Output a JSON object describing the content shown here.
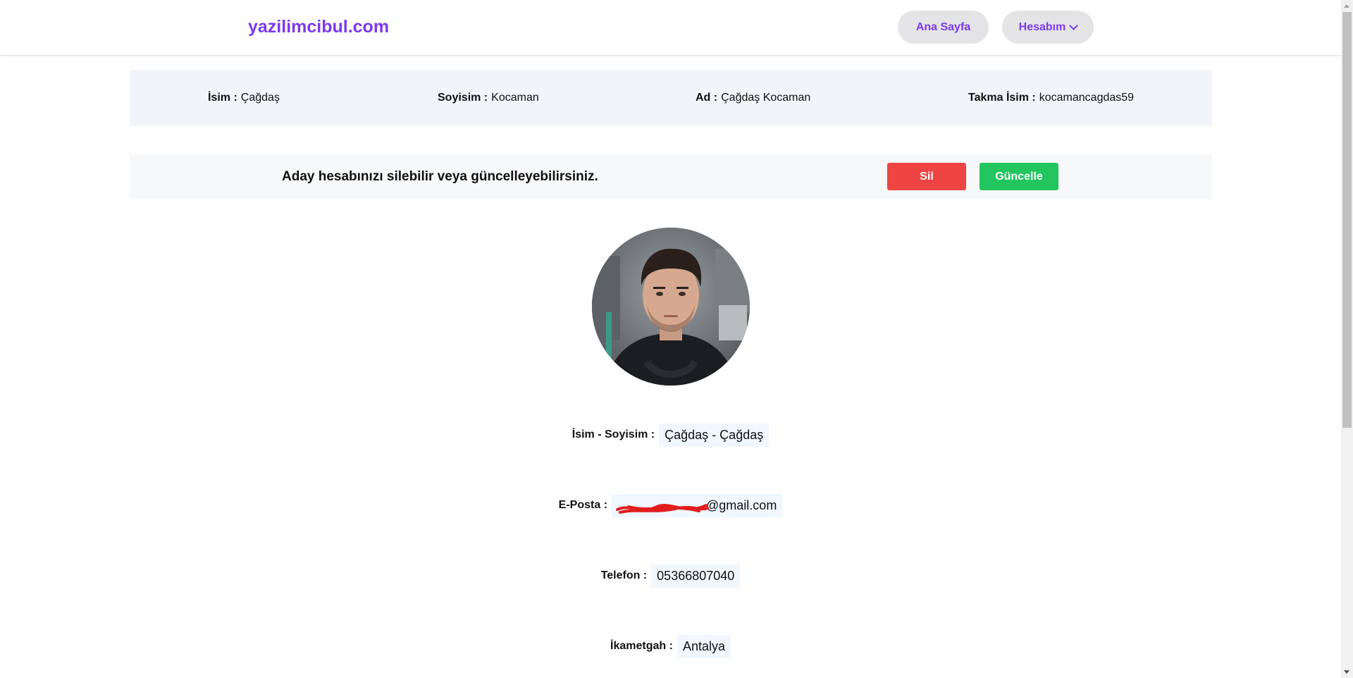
{
  "header": {
    "brand": "yazilimcibul.com",
    "nav_home": "Ana Sayfa",
    "nav_account": "Hesabım"
  },
  "info_bar": {
    "first_name_label": "İsim :",
    "first_name": "Çağdaş",
    "last_name_label": "Soyisim :",
    "last_name": "Kocaman",
    "full_name_label": "Ad :",
    "full_name": "Çağdaş Kocaman",
    "nickname_label": "Takma İsim :",
    "nickname": "kocamancagdas59"
  },
  "action_bar": {
    "message": "Aday hesabınızı silebilir veya güncelleyebilirsiniz.",
    "delete_label": "Sil",
    "update_label": "Güncelle"
  },
  "profile": {
    "avatar_icon": "profile-photo",
    "rows": [
      {
        "label": "İsim - Soyisim :",
        "value": "Çağdaş - Çağdaş"
      },
      {
        "label": "E-Posta :",
        "value": "@gmail.com"
      },
      {
        "label": "Telefon :",
        "value": "05366807040"
      },
      {
        "label": "İkametgah :",
        "value": "Antalya"
      }
    ]
  },
  "colors": {
    "brand": "#7c3aed",
    "nav_bg": "#e4e4e7",
    "delete": "#ef4444",
    "update": "#22c55e",
    "info_bg": "#f1f4f8",
    "value_bg": "#f0f7ff"
  }
}
